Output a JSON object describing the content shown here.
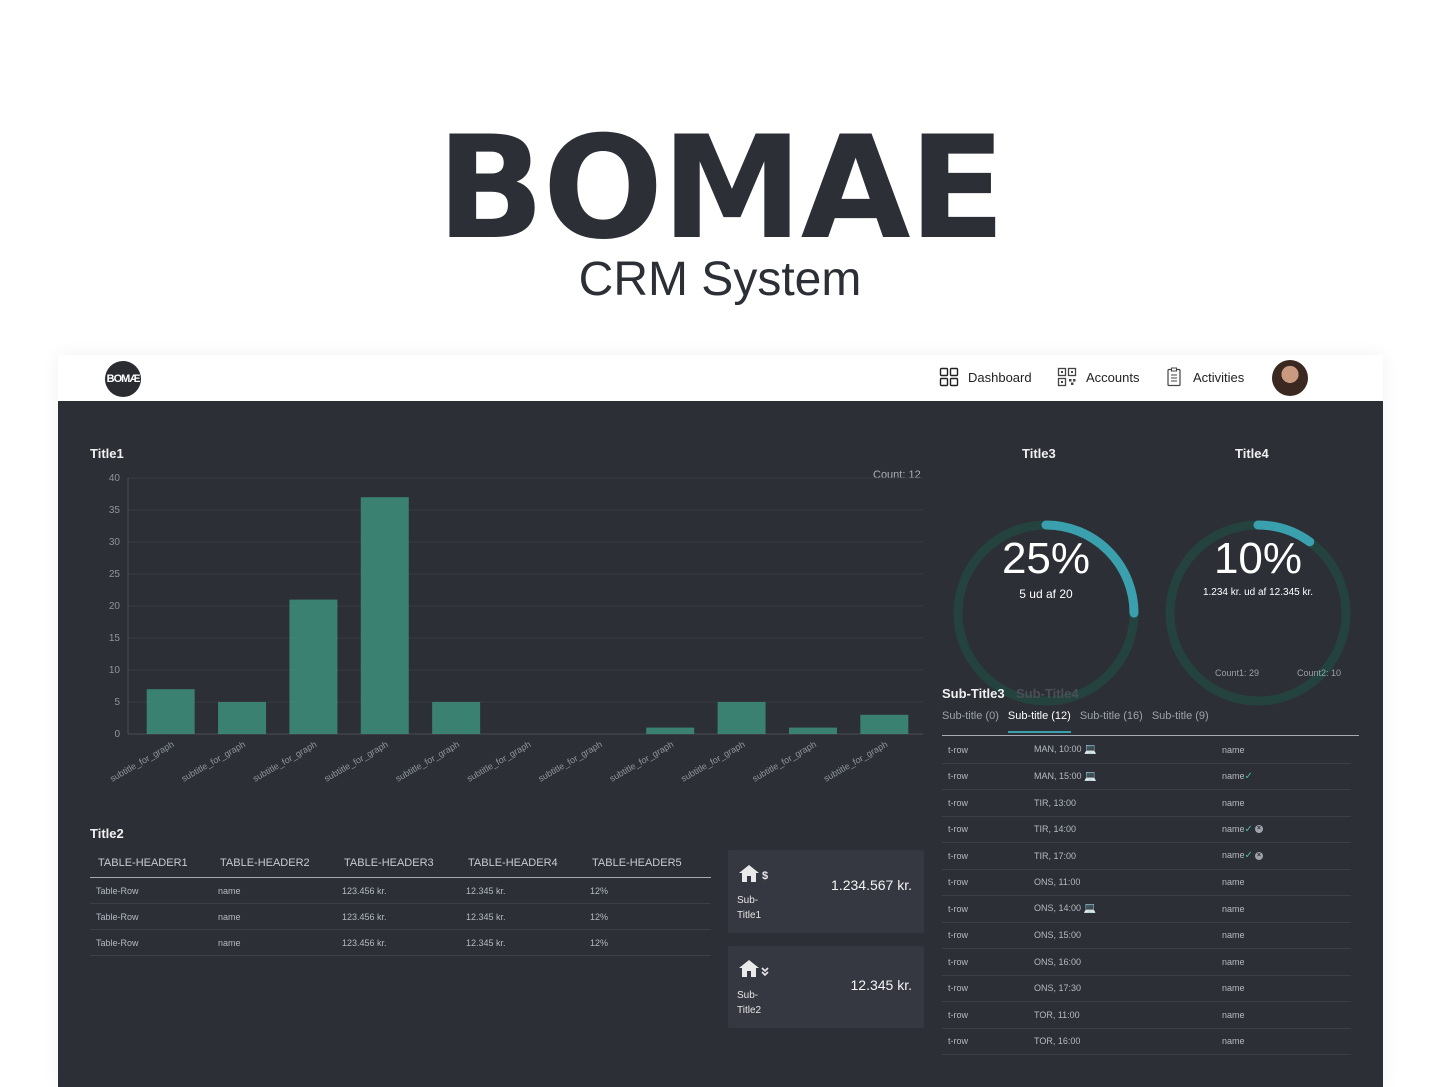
{
  "hero": {
    "title": "BOMAE",
    "subtitle": "CRM System"
  },
  "topbar": {
    "logo_text": "BOMÆ",
    "nav": [
      {
        "label": "Dashboard",
        "icon": "grid-icon"
      },
      {
        "label": "Accounts",
        "icon": "qr-code-icon"
      },
      {
        "label": "Activities",
        "icon": "clipboard-icon"
      }
    ]
  },
  "panel1": {
    "title": "Title1",
    "count": "Count: 12"
  },
  "chart_data": {
    "type": "bar",
    "categories": [
      "subtitle_for_graph",
      "subtitle_for_graph",
      "subtitle_for_graph",
      "subtitle_for_graph",
      "subtitle_for_graph",
      "subtitle_for_graph",
      "subtitle_for_graph",
      "subtitle_for_graph",
      "subtitle_for_graph",
      "subtitle_for_graph",
      "subtitle_for_graph"
    ],
    "values": [
      7,
      5,
      21,
      37,
      5,
      0,
      0,
      1,
      5,
      1,
      3
    ],
    "ylim": [
      0,
      40
    ],
    "yticks": [
      0,
      5,
      10,
      15,
      20,
      25,
      30,
      35,
      40
    ],
    "grid": true,
    "bar_color": "#3d8f7c"
  },
  "panel2": {
    "title": "Title2",
    "headers": [
      "TABLE-HEADER1",
      "TABLE-HEADER2",
      "TABLE-HEADER3",
      "TABLE-HEADER4",
      "TABLE-HEADER5"
    ],
    "rows": [
      [
        "Table-Row",
        "name",
        "123.456 kr.",
        "12.345 kr.",
        "12%"
      ],
      [
        "Table-Row",
        "name",
        "123.456 kr.",
        "12.345 kr.",
        "12%"
      ],
      [
        "Table-Row",
        "name",
        "123.456 kr.",
        "12.345 kr.",
        "12%"
      ]
    ]
  },
  "cards": [
    {
      "icon": "house-dollar-icon",
      "amount": "1.234.567 kr.",
      "line1": "Sub-",
      "line2": "Title1"
    },
    {
      "icon": "house-down-icon",
      "amount": "12.345 kr.",
      "line1": "Sub-",
      "line2": "Title2"
    }
  ],
  "gauges": [
    {
      "title": "Title3",
      "percent": "25%",
      "fraction": 0.25,
      "sub": "5 ud af 20"
    },
    {
      "title": "Title4",
      "percent": "10%",
      "fraction": 0.1,
      "sub": "1.234 kr. ud af 12.345 kr."
    }
  ],
  "counts": {
    "count1": "Count1: 29",
    "count2": "Count2: 10"
  },
  "panel3": {
    "tab_active": "Sub-Title3",
    "tab_inactive": "Sub-Title4",
    "subtabs": [
      "Sub-title (0)",
      "Sub-title (12)",
      "Sub-title (16)",
      "Sub-title (9)"
    ],
    "rows": [
      {
        "c1": "t-row",
        "c2": "MAN, 10:00",
        "laptop": true,
        "c3": "name",
        "check": false,
        "x": false
      },
      {
        "c1": "t-row",
        "c2": "MAN, 15:00",
        "laptop": true,
        "c3": "name",
        "check": true,
        "x": false
      },
      {
        "c1": "t-row",
        "c2": "TIR, 13:00",
        "laptop": false,
        "c3": "name",
        "check": false,
        "x": false
      },
      {
        "c1": "t-row",
        "c2": "TIR, 14:00",
        "laptop": false,
        "c3": "name",
        "check": true,
        "x": true
      },
      {
        "c1": "t-row",
        "c2": "TIR, 17:00",
        "laptop": false,
        "c3": "name",
        "check": true,
        "x": true
      },
      {
        "c1": "t-row",
        "c2": "ONS, 11:00",
        "laptop": false,
        "c3": "name",
        "check": false,
        "x": false
      },
      {
        "c1": "t-row",
        "c2": "ONS, 14:00",
        "laptop": true,
        "c3": "name",
        "check": false,
        "x": false
      },
      {
        "c1": "t-row",
        "c2": "ONS, 15:00",
        "laptop": false,
        "c3": "name",
        "check": false,
        "x": false
      },
      {
        "c1": "t-row",
        "c2": "ONS, 16:00",
        "laptop": false,
        "c3": "name",
        "check": false,
        "x": false
      },
      {
        "c1": "t-row",
        "c2": "ONS, 17:30",
        "laptop": false,
        "c3": "name",
        "check": false,
        "x": false
      },
      {
        "c1": "t-row",
        "c2": "TOR, 11:00",
        "laptop": false,
        "c3": "name",
        "check": false,
        "x": false
      },
      {
        "c1": "t-row",
        "c2": "TOR, 16:00",
        "laptop": false,
        "c3": "name",
        "check": false,
        "x": false
      }
    ]
  },
  "colors": {
    "bg": "#2c2f36",
    "accent": "#3aa0ae",
    "track": "#24433f",
    "bar": "#3d8f7c"
  }
}
